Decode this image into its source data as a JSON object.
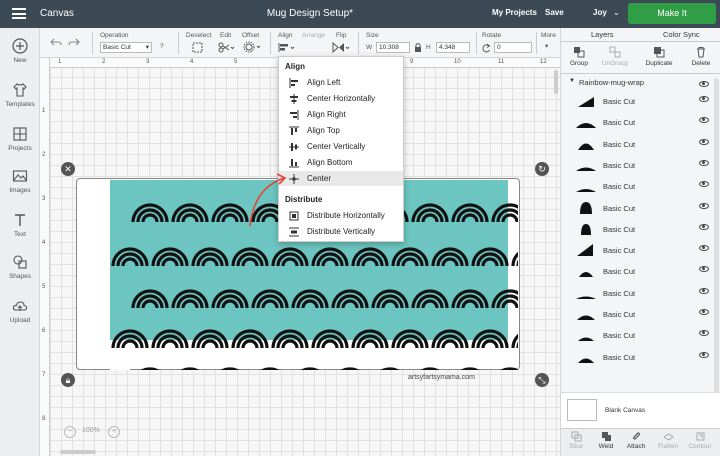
{
  "topbar": {
    "app_title": "Canvas",
    "project_title": "Mug Design Setup*",
    "my_projects": "My Projects",
    "save": "Save",
    "user": "Joy",
    "make_it": "Make It"
  },
  "leftrail": [
    {
      "label": "New",
      "icon": "plus-circle-icon"
    },
    {
      "label": "Templates",
      "icon": "shirt-icon"
    },
    {
      "label": "Projects",
      "icon": "grid-icon"
    },
    {
      "label": "Images",
      "icon": "image-icon"
    },
    {
      "label": "Text",
      "icon": "text-icon"
    },
    {
      "label": "Shapes",
      "icon": "shapes-icon"
    },
    {
      "label": "Upload",
      "icon": "upload-cloud-icon"
    }
  ],
  "toolbar": {
    "operation_label": "Operation",
    "operation_value": "Basic Cut",
    "help": "?",
    "deselect_label": "Deselect",
    "edit_label": "Edit",
    "offset_label": "Offset",
    "align_label": "Align",
    "arrange_label": "Arrange",
    "flip_label": "Flip",
    "size_label": "Size",
    "w_label": "W",
    "w_value": "10.308",
    "h_label": "H",
    "h_value": "4.348",
    "rotate_label": "Rotate",
    "rotate_value": "0",
    "more_label": "More"
  },
  "align_menu": {
    "align_heading": "Align",
    "items": [
      {
        "label": "Align Left",
        "icon": "align-left-icon"
      },
      {
        "label": "Center Horizontally",
        "icon": "center-horizontally-icon"
      },
      {
        "label": "Align Right",
        "icon": "align-right-icon"
      },
      {
        "label": "Align Top",
        "icon": "align-top-icon"
      },
      {
        "label": "Center Vertically",
        "icon": "center-vertically-icon"
      },
      {
        "label": "Align Bottom",
        "icon": "align-bottom-icon"
      },
      {
        "label": "Center",
        "icon": "center-icon",
        "selected": true
      }
    ],
    "distribute_heading": "Distribute",
    "distribute_items": [
      {
        "label": "Distribute Horizontally",
        "icon": "distribute-horizontally-icon"
      },
      {
        "label": "Distribute Vertically",
        "icon": "distribute-vertically-icon"
      }
    ]
  },
  "rightpanel": {
    "tabs": [
      "Layers",
      "Color Sync"
    ],
    "actions": [
      {
        "label": "Group",
        "disabled": false
      },
      {
        "label": "UnGroup",
        "disabled": true
      },
      {
        "label": "Duplicate",
        "disabled": false
      },
      {
        "label": "Delete",
        "disabled": false
      }
    ],
    "group_name": "Rainbow-mug-wrap",
    "layers": [
      "Basic Cut",
      "Basic Cut",
      "Basic Cut",
      "Basic Cut",
      "Basic Cut",
      "Basic Cut",
      "Basic Cut",
      "Basic Cut",
      "Basic Cut",
      "Basic Cut",
      "Basic Cut",
      "Basic Cut",
      "Basic Cut"
    ],
    "blank_canvas": "Blank Canvas",
    "bottom_actions": [
      {
        "label": "Slice",
        "active": false
      },
      {
        "label": "Weld",
        "active": true
      },
      {
        "label": "Attach",
        "active": true
      },
      {
        "label": "Flatten",
        "active": false
      },
      {
        "label": "Contour",
        "active": false
      }
    ]
  },
  "canvas": {
    "ruler_top": [
      "1",
      "2",
      "3",
      "4",
      "5",
      "6",
      "7",
      "8",
      "9",
      "10",
      "11",
      "12"
    ],
    "ruler_left": [
      "1",
      "2",
      "3",
      "4",
      "5",
      "6",
      "7",
      "8"
    ],
    "zoom": "100%",
    "zoom_out": "−",
    "zoom_in": "+",
    "watermark": "artsyfartsymama.com",
    "art_color": "#6cc5c0"
  }
}
